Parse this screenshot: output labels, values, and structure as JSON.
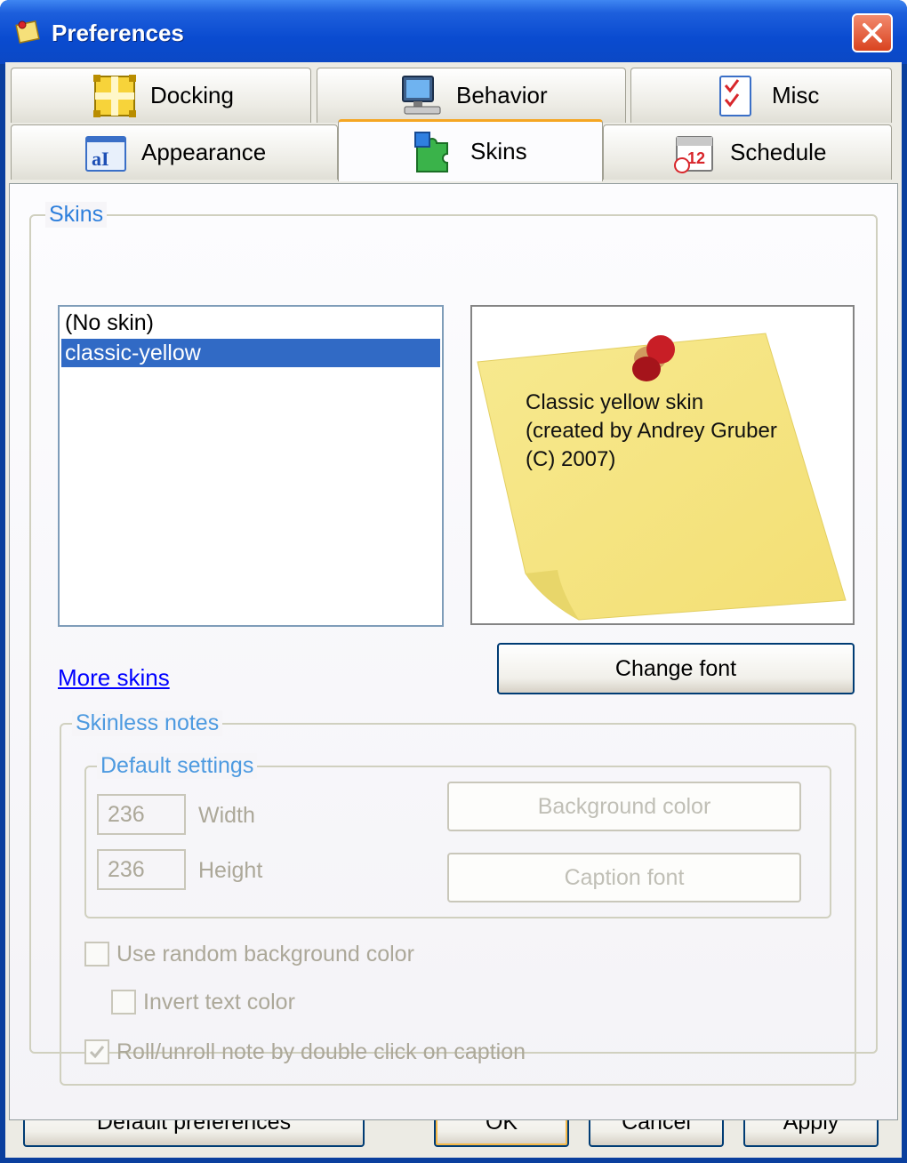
{
  "window": {
    "title": "Preferences"
  },
  "tabs": {
    "row1": [
      {
        "label": "Docking",
        "icon": "docking-icon"
      },
      {
        "label": "Behavior",
        "icon": "computer-icon"
      },
      {
        "label": "Misc",
        "icon": "checklist-icon"
      }
    ],
    "row2": [
      {
        "label": "Appearance",
        "icon": "font-icon"
      },
      {
        "label": "Skins",
        "icon": "puzzle-icon",
        "active": true
      },
      {
        "label": "Schedule",
        "icon": "calendar-icon"
      }
    ]
  },
  "skins": {
    "legend": "Skins",
    "items": [
      "(No skin)",
      "classic-yellow"
    ],
    "selected": "classic-yellow",
    "preview_text": "Classic yellow skin\n(created by Andrey Gruber\n(C) 2007)",
    "change_font": "Change font",
    "more_skins": "More skins"
  },
  "skinless": {
    "legend": "Skinless notes",
    "defaults_legend": "Default settings",
    "width_value": "236",
    "width_label": "Width",
    "height_value": "236",
    "height_label": "Height",
    "background_color": "Background color",
    "caption_font": "Caption font",
    "random_bg": "Use random background color",
    "invert_text": "Invert text color",
    "roll_unroll": "Roll/unroll note by double click on caption",
    "roll_unroll_checked": true
  },
  "footer": {
    "default_prefs": "Default preferences",
    "ok": "OK",
    "cancel": "Cancel",
    "apply": "Apply"
  },
  "colors": {
    "titlebar": "#0a4bd0",
    "selection": "#316ac5",
    "group_legend": "#2d7fdc",
    "note_yellow": "#f6e78a"
  }
}
